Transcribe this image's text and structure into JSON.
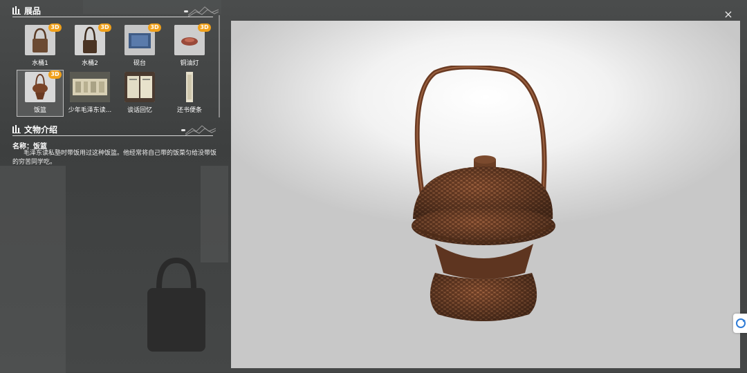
{
  "exhibits": {
    "title": "展品",
    "items": [
      {
        "label": "水桶1",
        "badge": "3D",
        "icon": "bucket-icon"
      },
      {
        "label": "水桶2",
        "badge": "3D",
        "icon": "bucket-icon"
      },
      {
        "label": "砚台",
        "badge": "3D",
        "icon": "inkstone-icon"
      },
      {
        "label": "铜油灯",
        "badge": "3D",
        "icon": "oil-lamp-icon"
      },
      {
        "label": "饭篮",
        "badge": "3D",
        "icon": "basket-icon",
        "selected": true
      },
      {
        "label": "少年毛泽东读...",
        "icon": "book-icon"
      },
      {
        "label": "谈话回忆",
        "icon": "document-icon"
      },
      {
        "label": "还书便条",
        "icon": "note-icon"
      }
    ]
  },
  "info": {
    "title": "文物介绍",
    "name": "名称：饭篮",
    "description": "毛泽东读私塾时带饭用过这种饭篮。他经常将自己带的饭菜匀给没带饭的穷苦同学吃。"
  },
  "viewer": {
    "close_label": "×",
    "model_icon": "rice-basket-3d-model"
  },
  "colors": {
    "badge": "#f0a01a",
    "accent": "#ffffff"
  }
}
